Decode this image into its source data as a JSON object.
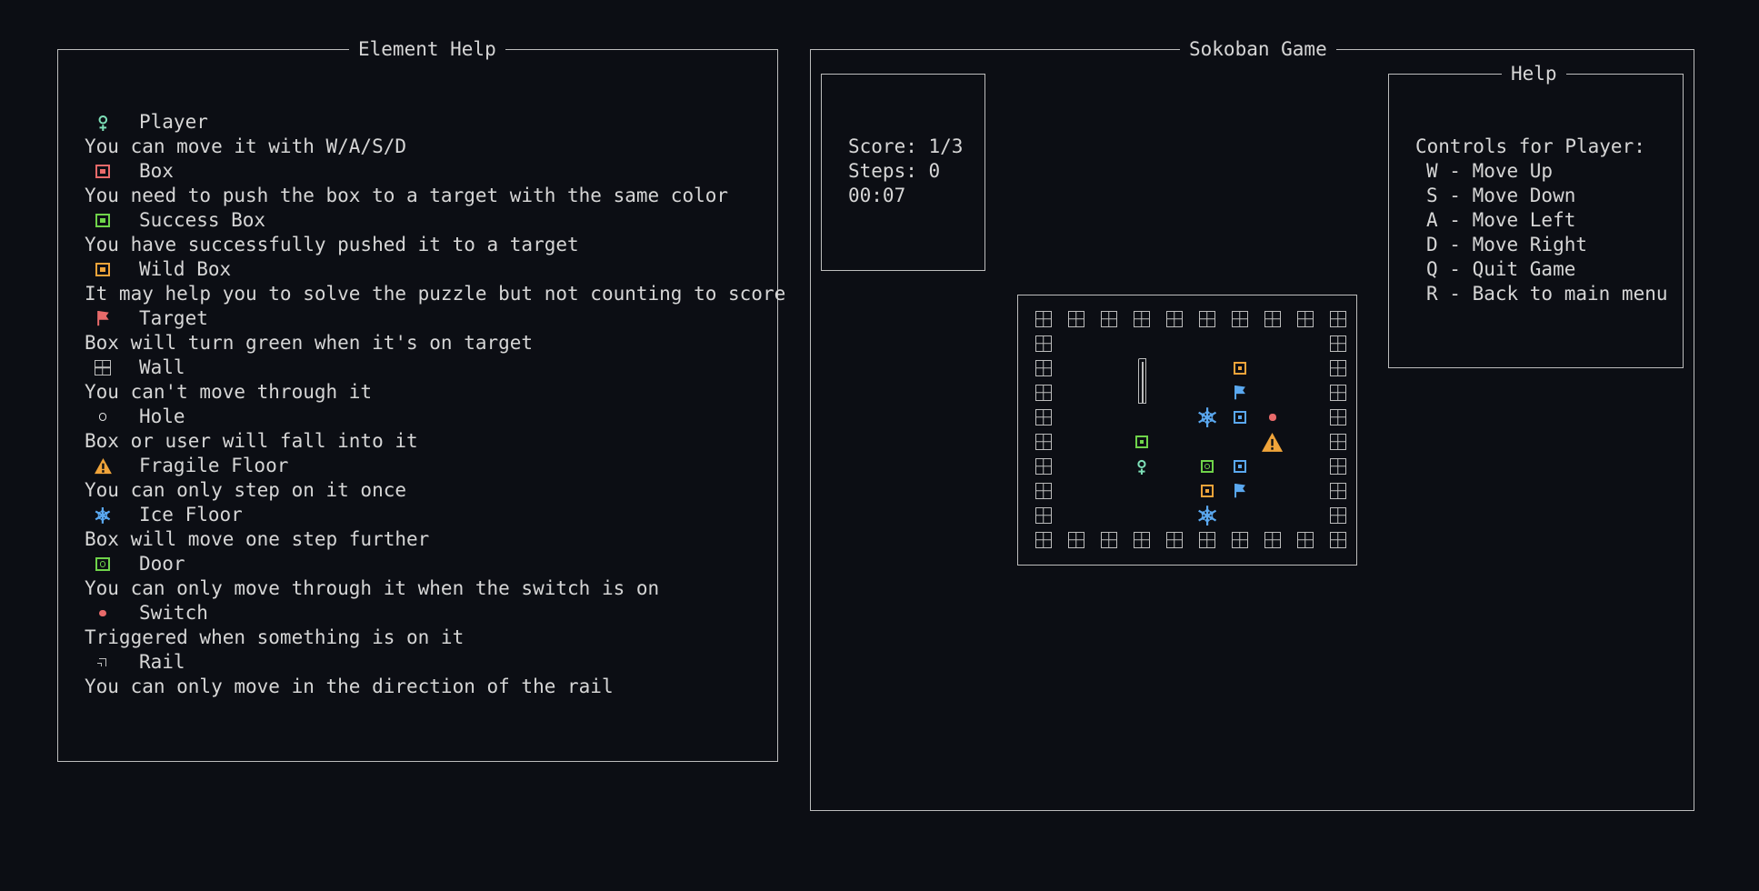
{
  "legend_panel": {
    "title": "Element Help",
    "items": [
      {
        "icon": "player-icon",
        "name": "Player",
        "description": "You can move it with W/A/S/D",
        "color": "#7ee0b8"
      },
      {
        "icon": "box-icon",
        "name": "Box",
        "description": "You need to push the box to a target with the same color",
        "color": "#e86a6a"
      },
      {
        "icon": "success-box-icon",
        "name": "Success Box",
        "description": "You have successfully pushed it to a target",
        "color": "#6fd34a"
      },
      {
        "icon": "wild-box-icon",
        "name": "Wild Box",
        "description": "It may help you to solve the puzzle but not counting to score",
        "color": "#f0a43a"
      },
      {
        "icon": "target-flag-icon",
        "name": "Target",
        "description": "Box will turn green when it's on target",
        "color": "#e86a6a"
      },
      {
        "icon": "wall-icon",
        "name": "Wall",
        "description": "You can't move through it",
        "color": "#bdbdbd"
      },
      {
        "icon": "hole-icon",
        "name": "Hole",
        "description": "Box or user will fall into it",
        "color": "#e4e4e4"
      },
      {
        "icon": "warning-icon",
        "name": "Fragile Floor",
        "description": "You can only step on it once",
        "color": "#f0a43a"
      },
      {
        "icon": "snowflake-icon",
        "name": "Ice Floor",
        "description": "Box will move one step further",
        "color": "#5aa8f0"
      },
      {
        "icon": "door-icon",
        "name": "Door",
        "description": "You can only move through it when the switch is on",
        "color": "#6fd34a"
      },
      {
        "icon": "switch-icon",
        "name": "Switch",
        "description": "Triggered when something is on it",
        "color": "#e86a6a"
      },
      {
        "icon": "rail-icon",
        "name": "Rail",
        "description": "You can only move in the direction of the rail",
        "color": "#bdbdbd"
      }
    ]
  },
  "game_panel": {
    "title": "Sokoban Game",
    "stats": {
      "score": "Score: 1/3",
      "steps": "Steps: 0",
      "timer": "00:07"
    },
    "help": {
      "title": "Help",
      "heading": "Controls for Player:",
      "controls": [
        "W - Move Up",
        "S - Move Down",
        "A - Move Left",
        "D - Move Right",
        "Q - Quit Game",
        "R - Back to main menu"
      ]
    },
    "board": {
      "columns": 10,
      "rows": 10,
      "cells": [
        {
          "row": 2,
          "col": 3,
          "type": "rail",
          "color": "#bdbdbd"
        },
        {
          "row": 3,
          "col": 3,
          "type": "rail",
          "color": "#bdbdbd"
        },
        {
          "row": 2,
          "col": 6,
          "type": "wild-box",
          "color": "#f0a43a"
        },
        {
          "row": 3,
          "col": 6,
          "type": "target",
          "color": "#5aa8f0"
        },
        {
          "row": 4,
          "col": 5,
          "type": "ice-floor",
          "color": "#5aa8f0"
        },
        {
          "row": 4,
          "col": 6,
          "type": "box",
          "color": "#5aa8f0"
        },
        {
          "row": 4,
          "col": 7,
          "type": "switch",
          "color": "#e86a6a"
        },
        {
          "row": 5,
          "col": 3,
          "type": "success-box",
          "color": "#6fd34a"
        },
        {
          "row": 5,
          "col": 7,
          "type": "fragile-floor",
          "color": "#f0a43a"
        },
        {
          "row": 6,
          "col": 3,
          "type": "player",
          "color": "#7ee0b8"
        },
        {
          "row": 6,
          "col": 5,
          "type": "door",
          "color": "#6fd34a"
        },
        {
          "row": 6,
          "col": 6,
          "type": "box",
          "color": "#5aa8f0"
        },
        {
          "row": 7,
          "col": 5,
          "type": "wild-box",
          "color": "#f0a43a"
        },
        {
          "row": 7,
          "col": 6,
          "type": "target",
          "color": "#5aa8f0"
        },
        {
          "row": 8,
          "col": 5,
          "type": "ice-floor",
          "color": "#5aa8f0"
        }
      ]
    }
  }
}
